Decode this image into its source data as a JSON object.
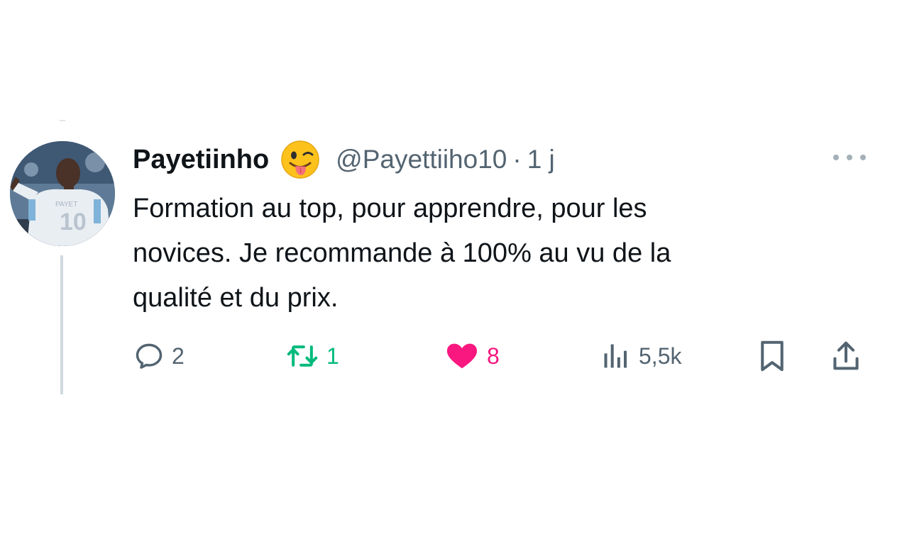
{
  "tweet": {
    "author_name": "Payetiinho",
    "author_emoji": "winking-face-with-tongue",
    "handle": "@Payettiiho10",
    "separator": "·",
    "time": "1 j",
    "text_lines": [
      "Formation au top, pour apprendre, pour les",
      "novices. Je recommande à 100% au vu de la",
      "qualité et du prix."
    ],
    "stats": {
      "replies": "2",
      "retweets": "1",
      "likes": "8",
      "views": "5,5k"
    }
  },
  "icons": {
    "reply": "reply-icon",
    "retweet": "retweet-icon",
    "like": "heart-icon",
    "views": "views-icon",
    "bookmark": "bookmark-icon",
    "share": "share-icon",
    "more": "more-icon"
  },
  "colors": {
    "text": "#0f1419",
    "secondary": "#536471",
    "retweet_active": "#00ba7c",
    "like_active": "#f91880",
    "thread_line": "#cfd9de"
  }
}
